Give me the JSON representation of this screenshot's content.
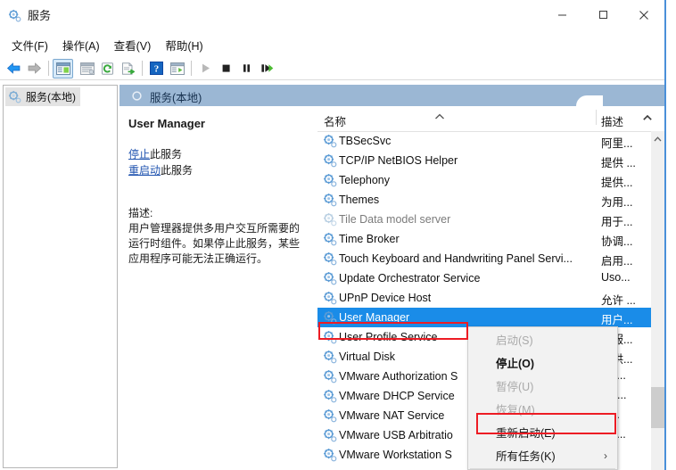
{
  "window": {
    "title": "服务",
    "title_icon": "services-gear-icon",
    "minimize_label": "最小化",
    "maximize_label": "最大化",
    "close_label": "关闭"
  },
  "menubar": {
    "items": [
      {
        "label": "文件(F)",
        "name": "menu-file"
      },
      {
        "label": "操作(A)",
        "name": "menu-action"
      },
      {
        "label": "查看(V)",
        "name": "menu-view"
      },
      {
        "label": "帮助(H)",
        "name": "menu-help"
      }
    ]
  },
  "toolbar": {
    "buttons": [
      {
        "name": "back-arrow-icon",
        "glyph": "back",
        "enabled": true
      },
      {
        "name": "forward-arrow-icon",
        "glyph": "forward",
        "enabled": false
      },
      {
        "name": "show-hide-tree-icon",
        "glyph": "panel",
        "enabled": true
      },
      {
        "name": "properties-icon",
        "glyph": "props",
        "enabled": true
      },
      {
        "name": "refresh-icon",
        "glyph": "refresh",
        "enabled": true
      },
      {
        "name": "export-list-icon",
        "glyph": "export",
        "enabled": true
      },
      {
        "name": "help-icon",
        "glyph": "help",
        "enabled": true
      },
      {
        "name": "show-action-pane-icon",
        "glyph": "panel2",
        "enabled": true
      },
      {
        "name": "start-service-icon",
        "glyph": "play",
        "enabled": false
      },
      {
        "name": "stop-service-icon",
        "glyph": "stop",
        "enabled": true
      },
      {
        "name": "pause-service-icon",
        "glyph": "pause",
        "enabled": true
      },
      {
        "name": "restart-service-icon",
        "glyph": "restart",
        "enabled": true
      }
    ]
  },
  "tree": {
    "root_label": "服务(本地)",
    "root_icon": "services-gear-icon"
  },
  "pane": {
    "header_label": "服务(本地)",
    "header_icon": "services-ring-icon"
  },
  "detail": {
    "service_name": "User Manager",
    "stop_link_text": "停止",
    "stop_link_suffix": "此服务",
    "restart_link_text": "重启动",
    "restart_link_suffix": "此服务",
    "description_label": "描述:",
    "description_body": "用户管理器提供多用户交互所需要的运行时组件。如果停止此服务，某些应用程序可能无法正确运行。"
  },
  "list": {
    "columns": {
      "name": "名称",
      "description": "描述"
    },
    "sort_indicator": "ascending",
    "rows": [
      {
        "name": "TBSecSvc",
        "desc": "阿里...",
        "selected": false,
        "dim": false
      },
      {
        "name": "TCP/IP NetBIOS Helper",
        "desc": "提供 ...",
        "selected": false,
        "dim": false
      },
      {
        "name": "Telephony",
        "desc": "提供...",
        "selected": false,
        "dim": false
      },
      {
        "name": "Themes",
        "desc": "为用...",
        "selected": false,
        "dim": false
      },
      {
        "name": "Tile Data model server",
        "desc": "用于...",
        "selected": false,
        "dim": true
      },
      {
        "name": "Time Broker",
        "desc": "协调...",
        "selected": false,
        "dim": false
      },
      {
        "name": "Touch Keyboard and Handwriting Panel Servi...",
        "desc": "启用...",
        "selected": false,
        "dim": false
      },
      {
        "name": "Update Orchestrator Service",
        "desc": "Uso...",
        "selected": false,
        "dim": false
      },
      {
        "name": "UPnP Device Host",
        "desc": "允许 ...",
        "selected": false,
        "dim": false
      },
      {
        "name": "User Manager",
        "desc": "用户...",
        "selected": true,
        "dim": false
      },
      {
        "name": "User Profile Service",
        "desc": "此服...",
        "selected": false,
        "dim": false
      },
      {
        "name": "Virtual Disk",
        "desc": "提供...",
        "selected": false,
        "dim": false
      },
      {
        "name": "VMware Authorization S",
        "desc": "uth...",
        "selected": false,
        "dim": false
      },
      {
        "name": "VMware DHCP Service",
        "desc": "HC...",
        "selected": false,
        "dim": false
      },
      {
        "name": "VMware NAT Service",
        "desc": "et...",
        "selected": false,
        "dim": false
      },
      {
        "name": "VMware USB Arbitratio",
        "desc": "rbit...",
        "selected": false,
        "dim": false
      },
      {
        "name": "VMware Workstation S",
        "desc": "",
        "selected": false,
        "dim": false
      }
    ]
  },
  "context_menu": {
    "items": [
      {
        "label": "启动(S)",
        "name": "ctx-start",
        "disabled": true,
        "bold": false,
        "submenu": false
      },
      {
        "label": "停止(O)",
        "name": "ctx-stop",
        "disabled": false,
        "bold": true,
        "submenu": false
      },
      {
        "label": "暂停(U)",
        "name": "ctx-pause",
        "disabled": true,
        "bold": false,
        "submenu": false
      },
      {
        "label": "恢复(M)",
        "name": "ctx-resume",
        "disabled": true,
        "bold": false,
        "submenu": false
      },
      {
        "label": "重新启动(E)",
        "name": "ctx-restart",
        "disabled": false,
        "bold": false,
        "submenu": false
      },
      {
        "label": "所有任务(K)",
        "name": "ctx-all-tasks",
        "disabled": false,
        "bold": false,
        "submenu": true
      }
    ],
    "submenu_arrow": "›"
  },
  "annotations": {
    "row_highlight_color": "#ed1c24",
    "menu_highlight_color": "#ed1c24",
    "selection_color": "#1a8ce8"
  }
}
